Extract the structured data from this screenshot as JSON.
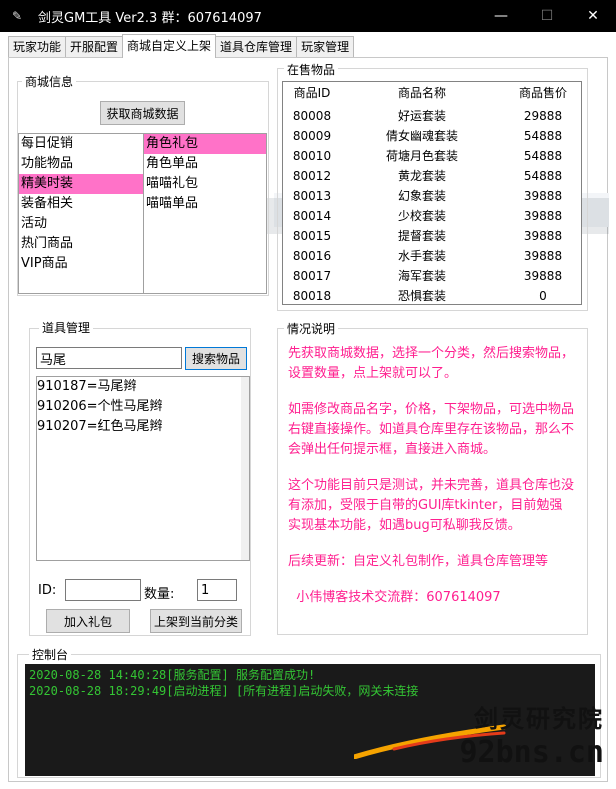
{
  "window": {
    "title": "剑灵GM工具 Ver2.3 群：607614097",
    "minimize": "—",
    "maximize": "☐",
    "close": "✕"
  },
  "tabs": [
    "玩家功能",
    "开服配置",
    "商城自定义上架",
    "道具仓库管理",
    "玩家管理"
  ],
  "shop_info": {
    "label": "商城信息",
    "fetch_button": "获取商城数据",
    "categories": [
      "每日促销",
      "功能物品",
      "精美时装",
      "装备相关",
      "活动",
      "热门商品",
      "VIP商品"
    ],
    "selected_category": "精美时装",
    "subcategories": [
      "角色礼包",
      "角色单品",
      "喵喵礼包",
      "喵喵单品"
    ],
    "selected_subcategory": "角色礼包"
  },
  "item_mgmt": {
    "label": "道具管理",
    "search_value": "马尾",
    "search_button": "搜索物品",
    "results": [
      "910187=马尾辫",
      "910206=个性马尾辫",
      "910207=红色马尾辫"
    ],
    "id_label": "ID:",
    "id_value": "",
    "qty_label": "数量:",
    "qty_value": "1",
    "add_pack_button": "加入礼包",
    "list_button": "上架到当前分类"
  },
  "on_sale": {
    "label": "在售物品",
    "columns": [
      "商品ID",
      "商品名称",
      "商品售价"
    ],
    "rows": [
      [
        "80008",
        "好运套装",
        "29888"
      ],
      [
        "80009",
        "倩女幽魂套装",
        "54888"
      ],
      [
        "80010",
        "荷塘月色套装",
        "54888"
      ],
      [
        "80012",
        "黄龙套装",
        "54888"
      ],
      [
        "80013",
        "幻象套装",
        "39888"
      ],
      [
        "80014",
        "少校套装",
        "39888"
      ],
      [
        "80015",
        "提督套装",
        "39888"
      ],
      [
        "80016",
        "水手套装",
        "39888"
      ],
      [
        "80017",
        "海军套装",
        "39888"
      ],
      [
        "80018",
        "恐惧套装",
        "0"
      ]
    ]
  },
  "info": {
    "label": "情况说明",
    "lines": [
      "先获取商城数据，选择一个分类，然后搜索物品，",
      "设置数量，点上架就可以了。",
      "",
      "如需修改商品名字，价格，下架物品，可选中物品",
      "右键直接操作。如道具仓库里存在该物品，那么不",
      "会弹出任何提示框，直接进入商城。",
      "",
      "这个功能目前只是测试，并未完善，道具仓库也没",
      "有添加，受限于自带的GUI库tkinter，目前勉强",
      "实现基本功能，如遇bug可私聊我反馈。",
      "",
      "后续更新：自定义礼包制作，道具仓库管理等",
      "",
      "  小伟博客技术交流群：607614097"
    ]
  },
  "console": {
    "label": "控制台",
    "lines": [
      "2020-08-28 14:40:28[服务配置] 服务配置成功!",
      "2020-08-28 18:29:49[启动进程] [所有进程]启动失败，网关未连接"
    ]
  },
  "watermark": {
    "top": "剑灵研究院",
    "bottom": "92bns.cn"
  },
  "colors": {
    "selection": "#ff72c8",
    "info_text": "#ff1f8f",
    "console_text": "#34c534",
    "console_bg": "#1a1a1a"
  }
}
